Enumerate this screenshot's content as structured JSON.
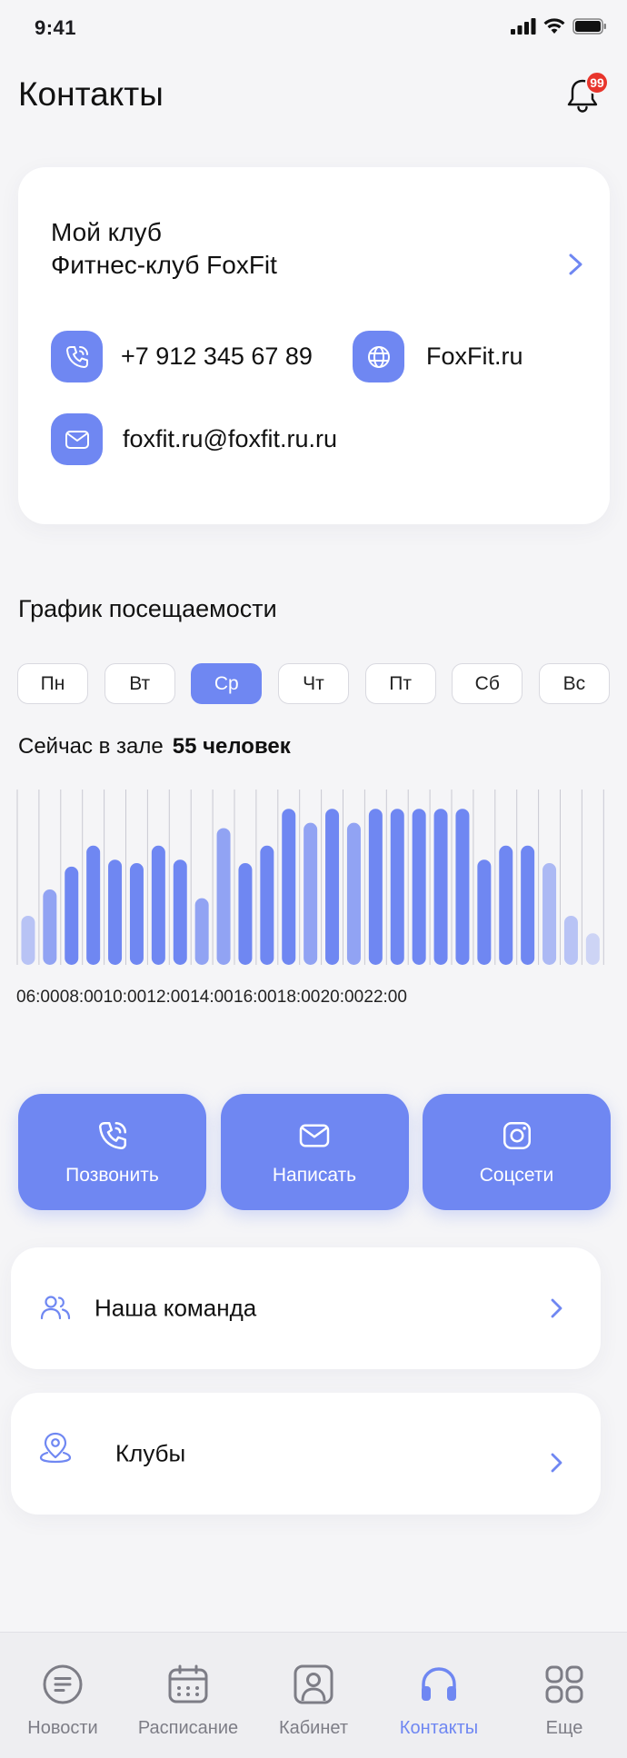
{
  "status_bar": {
    "time": "9:41"
  },
  "header": {
    "title": "Контакты",
    "notifications_count": "99"
  },
  "club": {
    "line1": "Мой клуб",
    "line2": "Фитнес-клуб FoxFit",
    "phone": "+7 912 345 67 89",
    "website": "FoxFit.ru",
    "email": "foxfit.ru@foxfit.ru.ru"
  },
  "attendance": {
    "title": "График посещаемости",
    "days": [
      "Пн",
      "Вт",
      "Ср",
      "Чт",
      "Пт",
      "Сб",
      "Вс"
    ],
    "active_day": "Ср",
    "now_label": "Сейчас в зале",
    "now_value": "55 человек"
  },
  "chart_data": {
    "type": "bar",
    "x_labels": [
      "06:00",
      "08:00",
      "10:00",
      "12:00",
      "14:00",
      "16:00",
      "18:00",
      "20:00",
      "22:00"
    ],
    "values": [
      0.28,
      0.43,
      0.56,
      0.68,
      0.6,
      0.58,
      0.68,
      0.6,
      0.38,
      0.78,
      0.58,
      0.68,
      0.89,
      0.81,
      0.89,
      0.81,
      0.89,
      0.89,
      0.89,
      0.89,
      0.89,
      0.6,
      0.68,
      0.68,
      0.58,
      0.28,
      0.18
    ],
    "opacity": [
      0.45,
      0.75,
      1,
      1,
      1,
      1,
      1,
      1,
      0.75,
      0.75,
      1,
      1,
      1,
      0.75,
      1,
      0.75,
      1,
      1,
      1,
      1,
      1,
      1,
      1,
      1,
      0.55,
      0.45,
      0.3
    ],
    "bar_color": "#6f87f2",
    "grid": true
  },
  "actions": {
    "call": "Позвонить",
    "write": "Написать",
    "social": "Соцсети"
  },
  "menu": {
    "team": "Наша команда",
    "clubs": "Клубы"
  },
  "tabbar": {
    "items": [
      {
        "label": "Новости",
        "icon": "news-icon"
      },
      {
        "label": "Расписание",
        "icon": "calendar-icon"
      },
      {
        "label": "Кабинет",
        "icon": "profile-icon"
      },
      {
        "label": "Контакты",
        "icon": "headphones-icon"
      },
      {
        "label": "Еще",
        "icon": "grid-icon"
      }
    ],
    "active": "Контакты"
  },
  "colors": {
    "accent": "#6f87f2",
    "badge": "#e8352c"
  }
}
